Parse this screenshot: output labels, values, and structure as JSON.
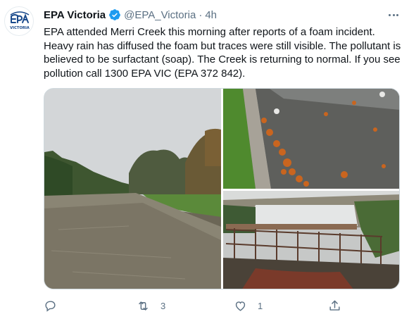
{
  "tweet": {
    "author": {
      "name": "EPA Victoria",
      "handle": "@EPA_Victoria",
      "time": "4h",
      "avatar": {
        "logo_text": "EPA",
        "logo_subtext": "VICTORIA",
        "color": "#1a4a8c"
      },
      "verified_color": "#1d9bf0"
    },
    "separator": "·",
    "text": "EPA  attended Merri Creek this morning after reports of a foam incident. Heavy rain has diffused the foam but traces were still visible. The pollutant is believed to be surfactant (soap). The Creek is returning to normal. If you see pollution call 1300 EPA VIC (EPA 372 842).",
    "media": {
      "images": [
        {
          "name": "creek-river-photo"
        },
        {
          "name": "leaves-footpath-photo"
        },
        {
          "name": "weir-waterfall-photo"
        }
      ]
    },
    "actions": {
      "reply": {
        "icon": "reply-icon",
        "count": ""
      },
      "retweet": {
        "icon": "retweet-icon",
        "count": "3"
      },
      "like": {
        "icon": "like-icon",
        "count": "1"
      },
      "share": {
        "icon": "share-icon",
        "count": ""
      }
    },
    "colors": {
      "text": "#0f1419",
      "secondary": "#5b7083",
      "border": "#cfd9de"
    }
  }
}
